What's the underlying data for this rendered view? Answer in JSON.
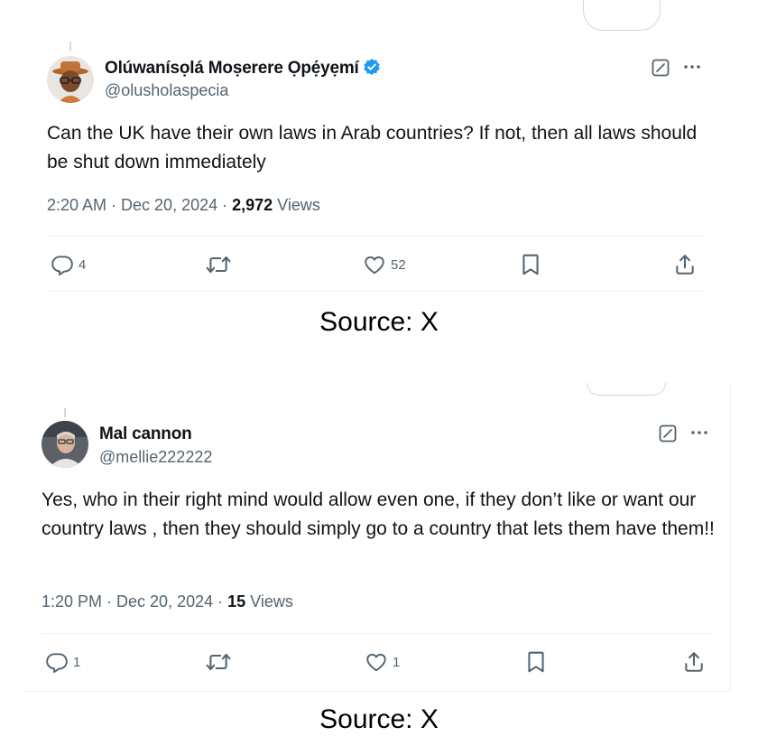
{
  "tweets": [
    {
      "display_name": "Olúwanísọlá Moṣerere Ọpẹ́yẹmí",
      "handle": "@olusholaspecia",
      "verified": true,
      "body": "Can the UK have their own laws in Arab countries? If not, then all laws should be shut down immediately",
      "time": "2:20 AM · Dec 20, 2024 · ",
      "views_count": "2,972",
      "views_label": " Views",
      "replies": "4",
      "reposts": "",
      "likes": "52"
    },
    {
      "display_name": "Mal cannon",
      "handle": "@mellie222222",
      "verified": false,
      "body": "Yes, who in their right mind would allow even one, if they don’t like or want our country laws , then they should simply go to a country that lets them have them!!",
      "time": "1:20 PM · Dec 20, 2024 · ",
      "views_count": "15",
      "views_label": " Views",
      "replies": "1",
      "reposts": "",
      "likes": "1"
    }
  ],
  "captions": [
    "Source: X",
    "Source: X"
  ],
  "colors": {
    "verified": "#1d9bf0",
    "muted": "#536471",
    "text": "#0f1419",
    "divider": "#eff3f4"
  },
  "icons": [
    "grok-icon",
    "more-icon",
    "reply-icon",
    "repost-icon",
    "like-icon",
    "bookmark-icon",
    "share-icon",
    "verified-badge-icon"
  ]
}
